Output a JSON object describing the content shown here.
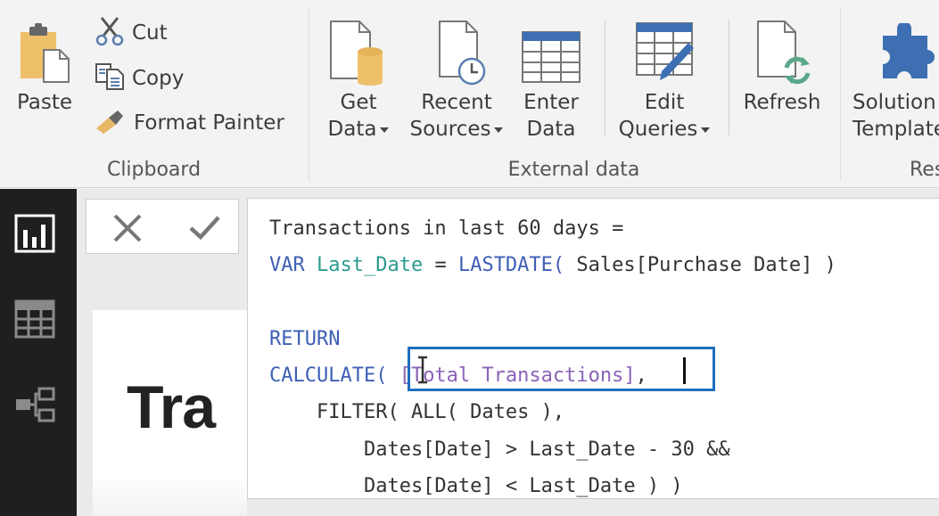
{
  "ribbon": {
    "clipboard": {
      "label": "Clipboard",
      "paste": "Paste",
      "cut": "Cut",
      "copy": "Copy",
      "format_painter": "Format Painter"
    },
    "external_data": {
      "label": "External data",
      "get_data": [
        "Get",
        "Data"
      ],
      "recent_sources": [
        "Recent",
        "Sources"
      ],
      "enter_data": [
        "Enter",
        "Data"
      ],
      "edit_queries": [
        "Edit",
        "Queries"
      ],
      "refresh": "Refresh"
    },
    "resources": {
      "label": "Res",
      "solution_templates": [
        "Solution",
        "Template"
      ]
    }
  },
  "leftnav": {
    "items": [
      {
        "name": "report-view",
        "icon": "bar-chart-icon"
      },
      {
        "name": "data-view",
        "icon": "table-grid-icon"
      },
      {
        "name": "relationships-view",
        "icon": "relationships-icon"
      }
    ]
  },
  "formula_bar": {
    "cancel_icon": "close-icon",
    "commit_icon": "checkmark-icon",
    "lines": [
      [
        {
          "t": "Transactions in last 60 days =",
          "c": "plain"
        }
      ],
      [
        {
          "t": "VAR ",
          "c": "kw"
        },
        {
          "t": "Last_Date",
          "c": "var"
        },
        {
          "t": " = ",
          "c": "plain"
        },
        {
          "t": "LASTDATE(",
          "c": "kw"
        },
        {
          "t": " Sales[Purchase Date] )",
          "c": "plain"
        }
      ],
      [
        {
          "t": "",
          "c": "plain"
        }
      ],
      [
        {
          "t": "RETURN",
          "c": "kw"
        }
      ],
      [
        {
          "t": "CALCULATE(",
          "c": "kw"
        },
        {
          "t": " [Total Transactions]",
          "c": "meas"
        },
        {
          "t": ",",
          "c": "plain"
        }
      ],
      [
        {
          "t": "    FILTER( ALL( Dates ),",
          "c": "plain"
        }
      ],
      [
        {
          "t": "        Dates[Date] > Last_Date - 30 &&",
          "c": "plain"
        }
      ],
      [
        {
          "t": "        Dates[Date] < Last_Date ) )",
          "c": "plain"
        }
      ]
    ],
    "highlighted_text": "[Total Transactions]"
  },
  "report": {
    "title_partial": "Tra"
  },
  "colors": {
    "keyword": "#3f5fb5",
    "variable": "#2b9b8f",
    "measure": "#8a63b8",
    "highlight_border": "#1e6fbf",
    "nav_bg": "#1f1f1f"
  }
}
